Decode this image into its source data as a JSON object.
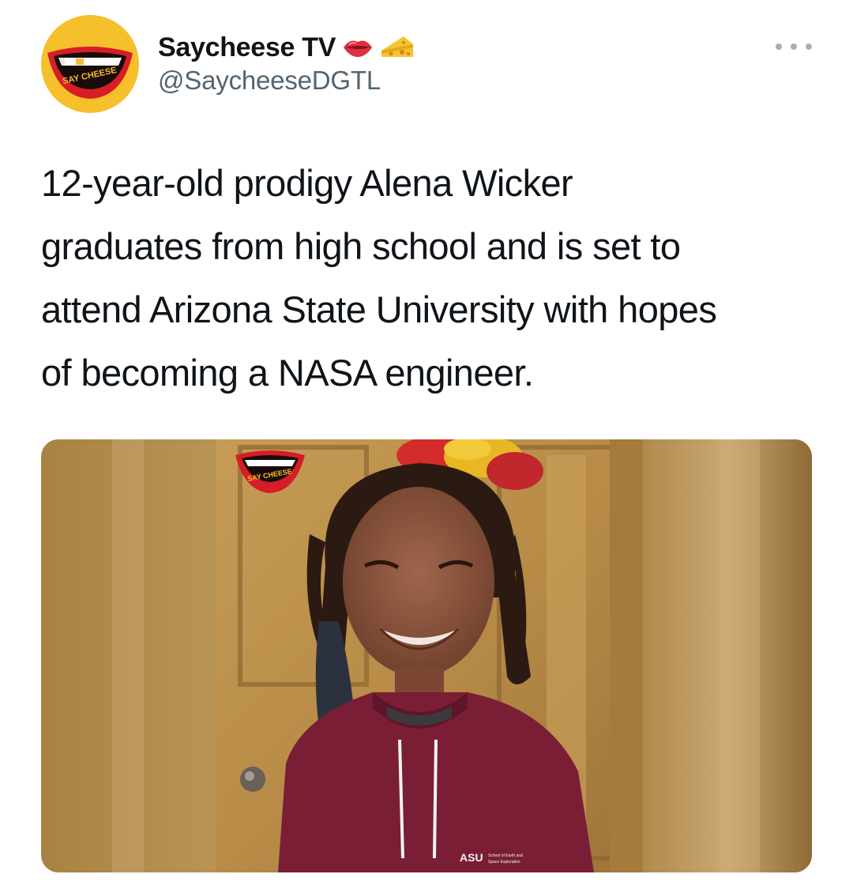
{
  "account": {
    "display_name": "Saycheese TV",
    "handle": "@SaycheeseDGTL",
    "name_emojis": [
      "lips-emoji",
      "cheese-emoji"
    ],
    "avatar_text": "SAY CHEESE"
  },
  "more_menu": {
    "icon": "more-dots-icon"
  },
  "tweet": {
    "lines": [
      "12-year-old prodigy Alena Wicker",
      "graduates from high school and is set to",
      "attend Arizona State University with hopes",
      "of becoming a NASA engineer."
    ]
  },
  "media": {
    "watermark_text": "SAY CHEESE",
    "shirt_logo": "ASU",
    "shirt_text_line1": "School of Earth and",
    "shirt_text_line2": "Space Exploration"
  },
  "colors": {
    "avatar_yellow": "#f6bf2c",
    "lips_red": "#d61d28",
    "handle_gray": "#536471",
    "hoodie_maroon": "#7a1e35",
    "door_wood": "#b8924f"
  }
}
